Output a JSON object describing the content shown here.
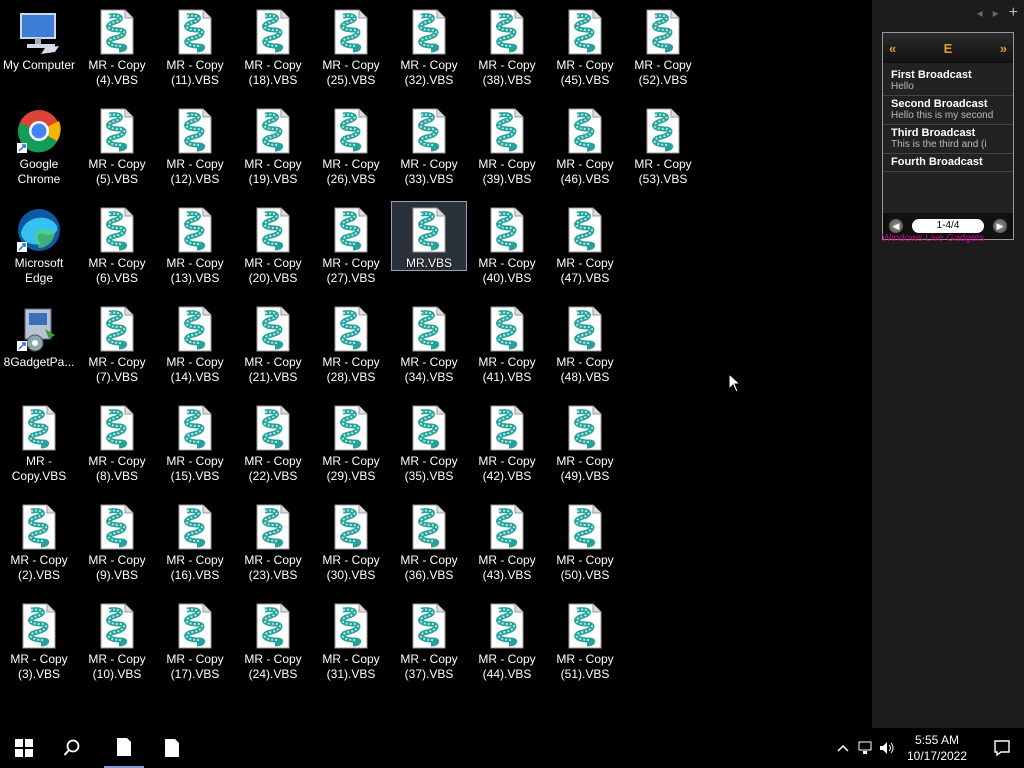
{
  "desktop": {
    "icons": [
      {
        "label": "My Computer",
        "type": "computer",
        "col": 0,
        "row": 0
      },
      {
        "label": "Google Chrome",
        "type": "chrome",
        "col": 0,
        "row": 1
      },
      {
        "label": "Microsoft Edge",
        "type": "edge",
        "col": 0,
        "row": 2
      },
      {
        "label": "8GadgetPa...",
        "type": "installer",
        "col": 0,
        "row": 3
      },
      {
        "label": "MR - Copy.VBS",
        "type": "vbs",
        "col": 0,
        "row": 4
      },
      {
        "label": "MR - Copy (2).VBS",
        "type": "vbs",
        "col": 0,
        "row": 5
      },
      {
        "label": "MR - Copy (3).VBS",
        "type": "vbs",
        "col": 0,
        "row": 6
      },
      {
        "label": "MR - Copy (4).VBS",
        "type": "vbs",
        "col": 1,
        "row": 0
      },
      {
        "label": "MR - Copy (5).VBS",
        "type": "vbs",
        "col": 1,
        "row": 1
      },
      {
        "label": "MR - Copy (6).VBS",
        "type": "vbs",
        "col": 1,
        "row": 2
      },
      {
        "label": "MR - Copy (7).VBS",
        "type": "vbs",
        "col": 1,
        "row": 3
      },
      {
        "label": "MR - Copy (8).VBS",
        "type": "vbs",
        "col": 1,
        "row": 4
      },
      {
        "label": "MR - Copy (9).VBS",
        "type": "vbs",
        "col": 1,
        "row": 5
      },
      {
        "label": "MR - Copy (10).VBS",
        "type": "vbs",
        "col": 1,
        "row": 6
      },
      {
        "label": "MR - Copy (11).VBS",
        "type": "vbs",
        "col": 2,
        "row": 0
      },
      {
        "label": "MR - Copy (12).VBS",
        "type": "vbs",
        "col": 2,
        "row": 1
      },
      {
        "label": "MR - Copy (13).VBS",
        "type": "vbs",
        "col": 2,
        "row": 2
      },
      {
        "label": "MR - Copy (14).VBS",
        "type": "vbs",
        "col": 2,
        "row": 3
      },
      {
        "label": "MR - Copy (15).VBS",
        "type": "vbs",
        "col": 2,
        "row": 4
      },
      {
        "label": "MR - Copy (16).VBS",
        "type": "vbs",
        "col": 2,
        "row": 5
      },
      {
        "label": "MR - Copy (17).VBS",
        "type": "vbs",
        "col": 2,
        "row": 6
      },
      {
        "label": "MR - Copy (18).VBS",
        "type": "vbs",
        "col": 3,
        "row": 0
      },
      {
        "label": "MR - Copy (19).VBS",
        "type": "vbs",
        "col": 3,
        "row": 1
      },
      {
        "label": "MR - Copy (20).VBS",
        "type": "vbs",
        "col": 3,
        "row": 2
      },
      {
        "label": "MR - Copy (21).VBS",
        "type": "vbs",
        "col": 3,
        "row": 3
      },
      {
        "label": "MR - Copy (22).VBS",
        "type": "vbs",
        "col": 3,
        "row": 4
      },
      {
        "label": "MR - Copy (23).VBS",
        "type": "vbs",
        "col": 3,
        "row": 5
      },
      {
        "label": "MR - Copy (24).VBS",
        "type": "vbs",
        "col": 3,
        "row": 6
      },
      {
        "label": "MR - Copy (25).VBS",
        "type": "vbs",
        "col": 4,
        "row": 0
      },
      {
        "label": "MR - Copy (26).VBS",
        "type": "vbs",
        "col": 4,
        "row": 1
      },
      {
        "label": "MR - Copy (27).VBS",
        "type": "vbs",
        "col": 4,
        "row": 2
      },
      {
        "label": "MR - Copy (28).VBS",
        "type": "vbs",
        "col": 4,
        "row": 3
      },
      {
        "label": "MR - Copy (29).VBS",
        "type": "vbs",
        "col": 4,
        "row": 4
      },
      {
        "label": "MR - Copy (30).VBS",
        "type": "vbs",
        "col": 4,
        "row": 5
      },
      {
        "label": "MR - Copy (31).VBS",
        "type": "vbs",
        "col": 4,
        "row": 6
      },
      {
        "label": "MR - Copy (32).VBS",
        "type": "vbs",
        "col": 5,
        "row": 0
      },
      {
        "label": "MR - Copy (33).VBS",
        "type": "vbs",
        "col": 5,
        "row": 1
      },
      {
        "label": "MR.VBS",
        "type": "vbs",
        "col": 5,
        "row": 2,
        "selected": true
      },
      {
        "label": "MR - Copy (34).VBS",
        "type": "vbs",
        "col": 5,
        "row": 3
      },
      {
        "label": "MR - Copy (35).VBS",
        "type": "vbs",
        "col": 5,
        "row": 4
      },
      {
        "label": "MR - Copy (36).VBS",
        "type": "vbs",
        "col": 5,
        "row": 5
      },
      {
        "label": "MR - Copy (37).VBS",
        "type": "vbs",
        "col": 5,
        "row": 6
      },
      {
        "label": "MR - Copy (38).VBS",
        "type": "vbs",
        "col": 6,
        "row": 0
      },
      {
        "label": "MR - Copy (39).VBS",
        "type": "vbs",
        "col": 6,
        "row": 1
      },
      {
        "label": "MR - Copy (40).VBS",
        "type": "vbs",
        "col": 6,
        "row": 2
      },
      {
        "label": "MR - Copy (41).VBS",
        "type": "vbs",
        "col": 6,
        "row": 3
      },
      {
        "label": "MR - Copy (42).VBS",
        "type": "vbs",
        "col": 6,
        "row": 4
      },
      {
        "label": "MR - Copy (43).VBS",
        "type": "vbs",
        "col": 6,
        "row": 5
      },
      {
        "label": "MR - Copy (44).VBS",
        "type": "vbs",
        "col": 6,
        "row": 6
      },
      {
        "label": "MR - Copy (45).VBS",
        "type": "vbs",
        "col": 7,
        "row": 0
      },
      {
        "label": "MR - Copy (46).VBS",
        "type": "vbs",
        "col": 7,
        "row": 1
      },
      {
        "label": "MR - Copy (47).VBS",
        "type": "vbs",
        "col": 7,
        "row": 2
      },
      {
        "label": "MR - Copy (48).VBS",
        "type": "vbs",
        "col": 7,
        "row": 3
      },
      {
        "label": "MR - Copy (49).VBS",
        "type": "vbs",
        "col": 7,
        "row": 4
      },
      {
        "label": "MR - Copy (50).VBS",
        "type": "vbs",
        "col": 7,
        "row": 5
      },
      {
        "label": "MR - Copy (51).VBS",
        "type": "vbs",
        "col": 7,
        "row": 6
      },
      {
        "label": "MR - Copy (52).VBS",
        "type": "vbs",
        "col": 8,
        "row": 0
      },
      {
        "label": "MR - Copy (53).VBS",
        "type": "vbs",
        "col": 8,
        "row": 1
      }
    ]
  },
  "sidebar": {
    "top_controls": {
      "prev": "◂",
      "next": "▸",
      "add": "+"
    }
  },
  "gadget": {
    "header_left": "«",
    "header_center": "E",
    "header_right": "»",
    "broadcasts": [
      {
        "title": "First Broadcast",
        "body": "Hello"
      },
      {
        "title": "Second Broadcast",
        "body": "Hello this is my second"
      },
      {
        "title": "Third Broadcast",
        "body": "This is the third and (i"
      },
      {
        "title": "Fourth Broadcast",
        "body": ""
      }
    ],
    "page_indicator": "1-4/4",
    "caption": "Windows Live Gadgets"
  },
  "taskbar": {
    "time": "5:55 AM",
    "date": "10/17/2022"
  },
  "colors": {
    "accent": "#e39a2f",
    "taskbar_active": "#7aa0d4"
  }
}
